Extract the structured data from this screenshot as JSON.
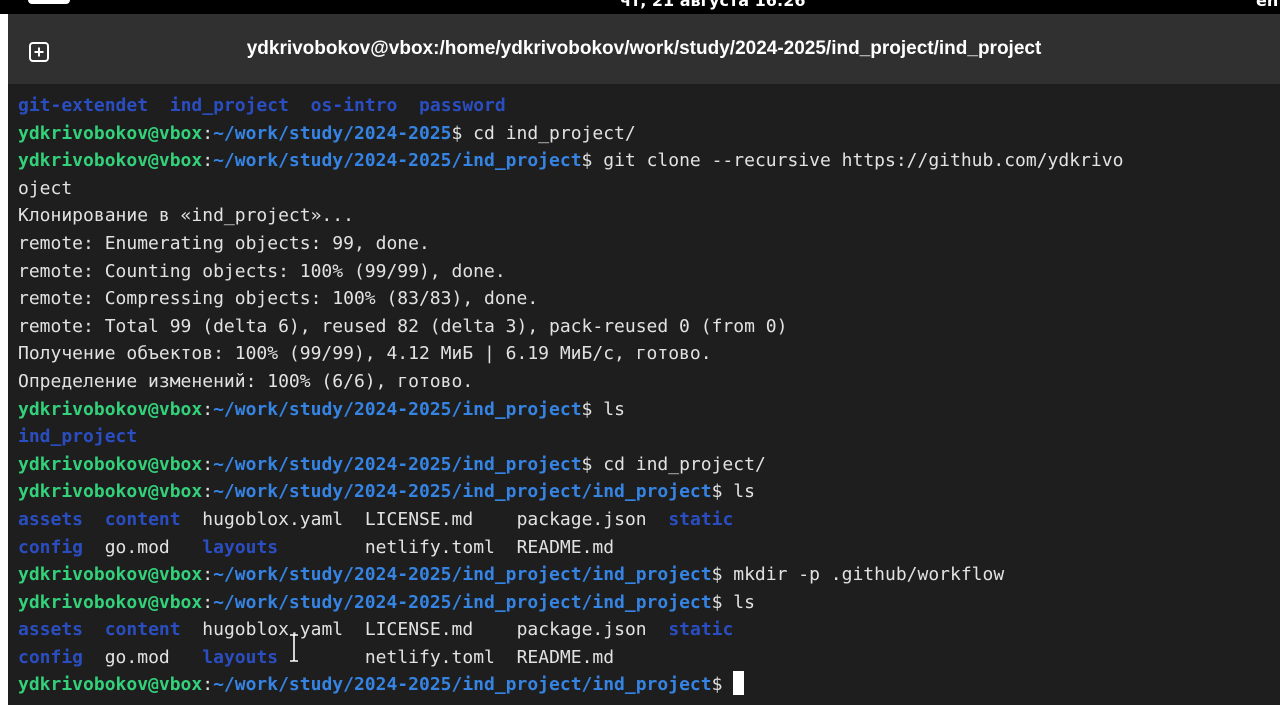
{
  "system_bar": {
    "clock": "чт, 21 августа 16:26",
    "lang": "en"
  },
  "window": {
    "title": "ydkrivobokov@vbox:/home/ydkrivobokov/work/study/2024-2025/ind_project/ind_project",
    "new_tab_icon": "new-tab-icon"
  },
  "colors": {
    "prompt_user": "#33d17a",
    "prompt_path": "#3584e4",
    "directory": "#2a4ec2",
    "text": "#e2e2e2",
    "background": "#1e1e1e",
    "titlebar": "#303030"
  },
  "terminal": {
    "lines": [
      {
        "type": "ls",
        "cols": [
          {
            "text": "git-extendet",
            "kind": "dir"
          },
          {
            "text": "  "
          },
          {
            "text": "ind_project",
            "kind": "dir"
          },
          {
            "text": "  "
          },
          {
            "text": "os-intro",
            "kind": "dir"
          },
          {
            "text": "  "
          },
          {
            "text": "password",
            "kind": "dir"
          }
        ]
      },
      {
        "type": "prompt",
        "user": "ydkrivobokov@vbox",
        "path": "~/work/study/2024-2025",
        "cmd": " cd ind_project/"
      },
      {
        "type": "prompt",
        "user": "ydkrivobokov@vbox",
        "path": "~/work/study/2024-2025/ind_project",
        "cmd": " git clone --recursive https://github.com/ydkrivo"
      },
      {
        "type": "text",
        "text": "oject"
      },
      {
        "type": "text",
        "text": "Клонирование в «ind_project»..."
      },
      {
        "type": "text",
        "text": "remote: Enumerating objects: 99, done."
      },
      {
        "type": "text",
        "text": "remote: Counting objects: 100% (99/99), done."
      },
      {
        "type": "text",
        "text": "remote: Compressing objects: 100% (83/83), done."
      },
      {
        "type": "text",
        "text": "remote: Total 99 (delta 6), reused 82 (delta 3), pack-reused 0 (from 0)"
      },
      {
        "type": "text",
        "text": "Получение объектов: 100% (99/99), 4.12 МиБ | 6.19 МиБ/с, готово."
      },
      {
        "type": "text",
        "text": "Определение изменений: 100% (6/6), готово."
      },
      {
        "type": "prompt",
        "user": "ydkrivobokov@vbox",
        "path": "~/work/study/2024-2025/ind_project",
        "cmd": " ls"
      },
      {
        "type": "ls",
        "cols": [
          {
            "text": "ind_project",
            "kind": "dir"
          }
        ]
      },
      {
        "type": "prompt",
        "user": "ydkrivobokov@vbox",
        "path": "~/work/study/2024-2025/ind_project",
        "cmd": " cd ind_project/"
      },
      {
        "type": "prompt",
        "user": "ydkrivobokov@vbox",
        "path": "~/work/study/2024-2025/ind_project/ind_project",
        "cmd": " ls"
      },
      {
        "type": "ls",
        "cols": [
          {
            "text": "assets",
            "kind": "dir"
          },
          {
            "text": "  "
          },
          {
            "text": "content",
            "kind": "dir"
          },
          {
            "text": "  "
          },
          {
            "text": "hugoblox.yaml",
            "kind": "file"
          },
          {
            "text": "  "
          },
          {
            "text": "LICENSE.md",
            "kind": "file"
          },
          {
            "text": "    "
          },
          {
            "text": "package.json",
            "kind": "file"
          },
          {
            "text": "  "
          },
          {
            "text": "static",
            "kind": "dir"
          }
        ]
      },
      {
        "type": "ls",
        "cols": [
          {
            "text": "config",
            "kind": "dir"
          },
          {
            "text": "  "
          },
          {
            "text": "go.mod",
            "kind": "file"
          },
          {
            "text": "   "
          },
          {
            "text": "layouts",
            "kind": "dir"
          },
          {
            "text": "        "
          },
          {
            "text": "netlify.toml",
            "kind": "file"
          },
          {
            "text": "  "
          },
          {
            "text": "README.md",
            "kind": "file"
          }
        ]
      },
      {
        "type": "prompt",
        "user": "ydkrivobokov@vbox",
        "path": "~/work/study/2024-2025/ind_project/ind_project",
        "cmd": " mkdir -p .github/workflow"
      },
      {
        "type": "prompt",
        "user": "ydkrivobokov@vbox",
        "path": "~/work/study/2024-2025/ind_project/ind_project",
        "cmd": " ls"
      },
      {
        "type": "ls",
        "cols": [
          {
            "text": "assets",
            "kind": "dir"
          },
          {
            "text": "  "
          },
          {
            "text": "content",
            "kind": "dir"
          },
          {
            "text": "  "
          },
          {
            "text": "hugoblox.yaml",
            "kind": "file"
          },
          {
            "text": "  "
          },
          {
            "text": "LICENSE.md",
            "kind": "file"
          },
          {
            "text": "    "
          },
          {
            "text": "package.json",
            "kind": "file"
          },
          {
            "text": "  "
          },
          {
            "text": "static",
            "kind": "dir"
          }
        ]
      },
      {
        "type": "ls",
        "cols": [
          {
            "text": "config",
            "kind": "dir"
          },
          {
            "text": "  "
          },
          {
            "text": "go.mod",
            "kind": "file"
          },
          {
            "text": "   "
          },
          {
            "text": "layouts",
            "kind": "dir"
          },
          {
            "text": "        "
          },
          {
            "text": "netlify.toml",
            "kind": "file"
          },
          {
            "text": "  "
          },
          {
            "text": "README.md",
            "kind": "file"
          }
        ]
      },
      {
        "type": "prompt",
        "user": "ydkrivobokov@vbox",
        "path": "~/work/study/2024-2025/ind_project/ind_project",
        "cmd": " ",
        "cursor": true
      }
    ]
  },
  "mouse_cursor_icon": "text-ibeam-cursor-icon"
}
